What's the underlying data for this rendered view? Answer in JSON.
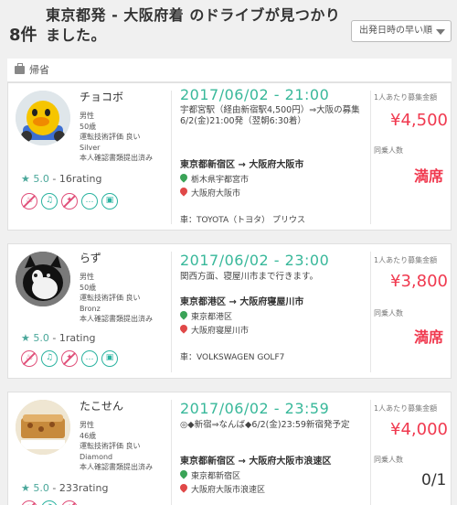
{
  "header": {
    "count": "8件",
    "title": "東京都発 - 大阪府着 のドライブが見つかりました。",
    "sort": "出発日時の早い順"
  },
  "category": {
    "label": "帰省"
  },
  "labels": {
    "price": "1人あたり募集金額",
    "passengers": "同乗人数"
  },
  "cards": [
    {
      "driver": {
        "name": "チョコボ",
        "gender": "男性",
        "age": "50歳",
        "skill": "運転技術評価 良い",
        "rank": "Silver",
        "verified": "本人確認書類提出済み"
      },
      "rating": {
        "score": "5.0",
        "text": "- 16rating"
      },
      "prefs": [
        "no-smoking-icon",
        "music-icon",
        "no-food-icon",
        "chat-icon",
        "luggage-icon"
      ],
      "datetime": "2017/06/02 - 21:00",
      "desc": "宇都宮駅（経由新宿駅4,500円）⇒大阪の募集　6/2(金)21:00発（翌朝6:30着）",
      "route": "東京都新宿区 → 大阪府大阪市",
      "from": "栃木県宇都宮市",
      "to": "大阪府大阪市",
      "car": "車：TOYOTA（トヨタ） プリウス",
      "price": "¥4,500",
      "status": "満席"
    },
    {
      "driver": {
        "name": "らず",
        "gender": "男性",
        "age": "50歳",
        "skill": "運転技術評価 良い",
        "rank": "Bronz",
        "verified": "本人確認書類提出済み"
      },
      "rating": {
        "score": "5.0",
        "text": "- 1rating"
      },
      "prefs": [
        "no-smoking-icon",
        "music-icon",
        "no-food-icon",
        "chat-icon",
        "luggage-icon"
      ],
      "datetime": "2017/06/02 - 23:00",
      "desc": "関西方面、寝屋川市まで行きます。",
      "route": "東京都港区 → 大阪府寝屋川市",
      "from": "東京都港区",
      "to": "大阪府寝屋川市",
      "car": "車：VOLKSWAGEN GOLF7",
      "price": "¥3,800",
      "status": "満席"
    },
    {
      "driver": {
        "name": "たこせん",
        "gender": "男性",
        "age": "46歳",
        "skill": "運転技術評価 良い",
        "rank": "Diamond",
        "verified": "本人確認書類提出済み"
      },
      "rating": {
        "score": "5.0",
        "text": "- 233rating"
      },
      "prefs": [
        "no-smoking-icon",
        "music-icon",
        "no-food-icon"
      ],
      "datetime": "2017/06/02 - 23:59",
      "desc": "◎◆新宿⇒なんば◆6/2(金)23:59新宿発予定",
      "route": "東京都新宿区 → 大阪府大阪市浪速区",
      "from": "東京都新宿区",
      "to": "大阪府大阪市浪速区",
      "car": "",
      "price": "¥4,000",
      "status": "0/1"
    }
  ]
}
